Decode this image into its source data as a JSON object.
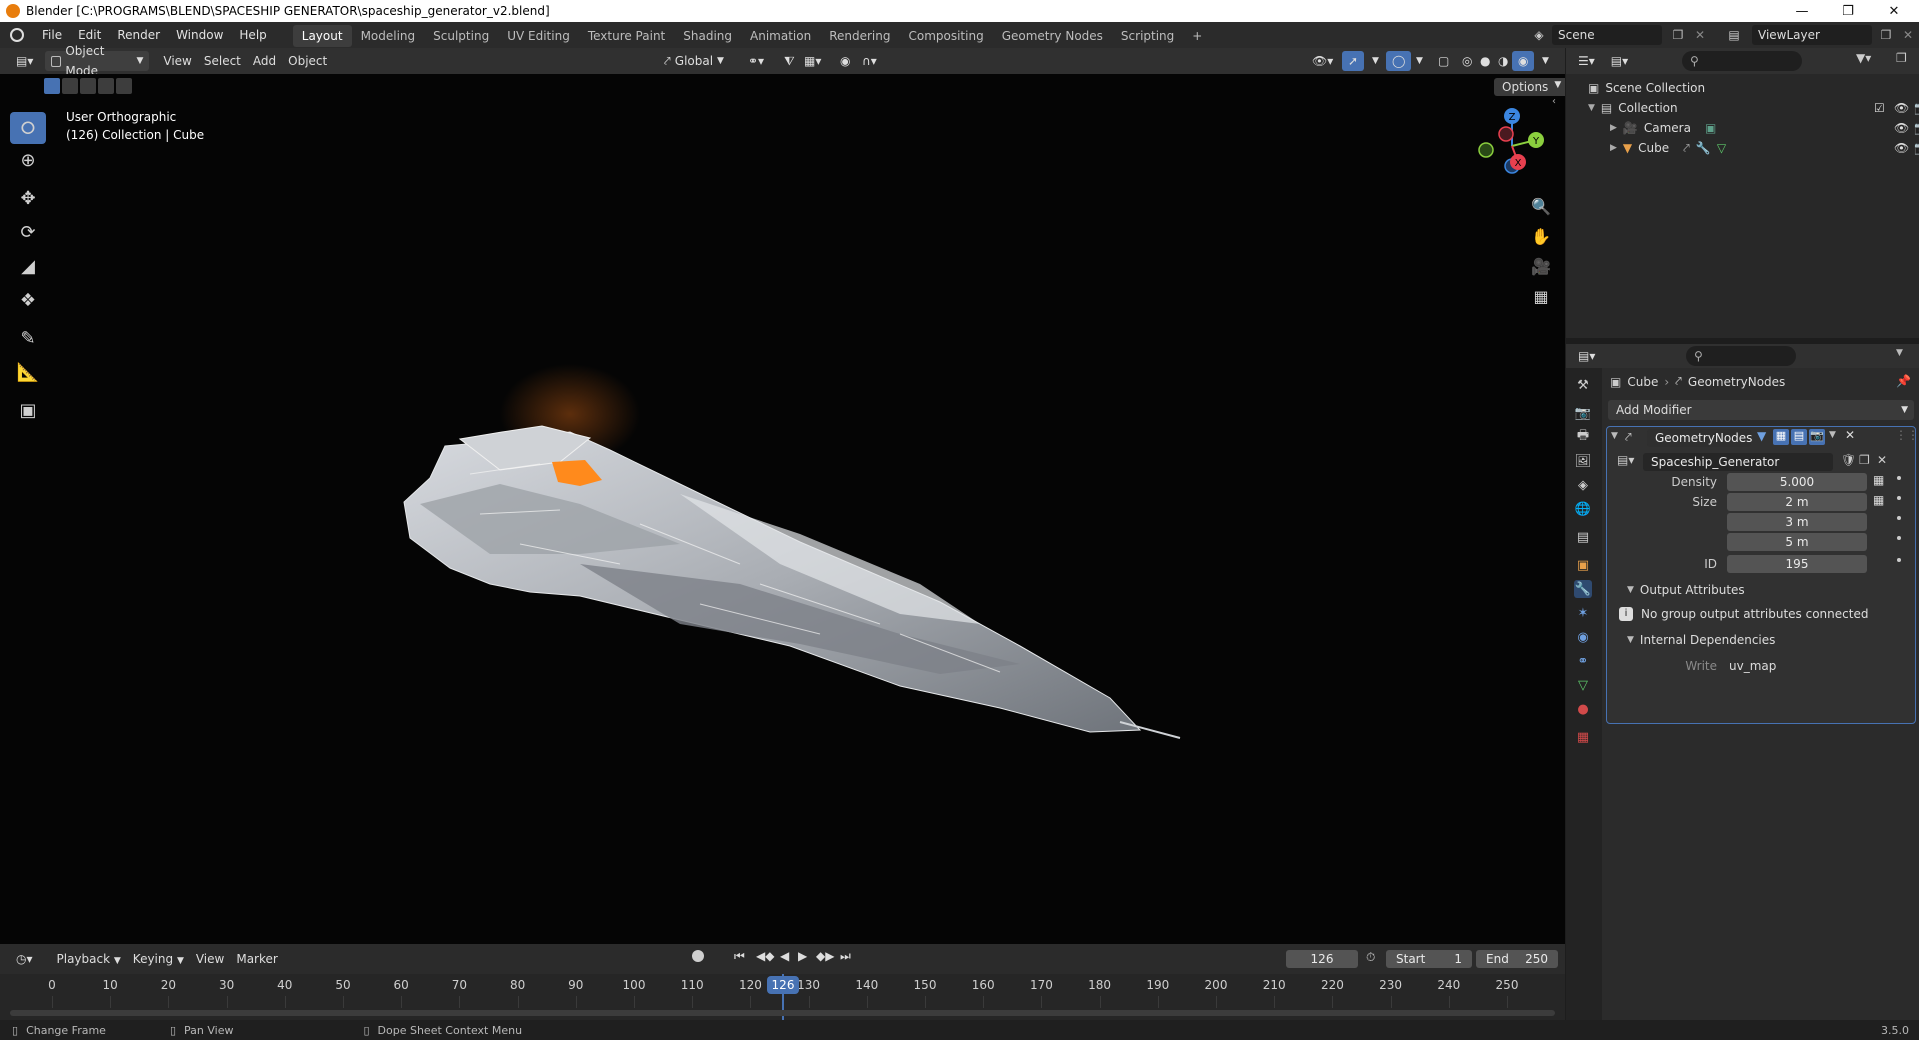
{
  "window": {
    "title": "Blender [C:\\PROGRAMS\\BLEND\\SPACESHIP GENERATOR\\spaceship_generator_v2.blend]",
    "minimize": "—",
    "restore": "❐",
    "close": "✕"
  },
  "menu": [
    "File",
    "Edit",
    "Render",
    "Window",
    "Help"
  ],
  "workspaces": [
    "Layout",
    "Modeling",
    "Sculpting",
    "UV Editing",
    "Texture Paint",
    "Shading",
    "Animation",
    "Rendering",
    "Compositing",
    "Geometry Nodes",
    "Scripting"
  ],
  "workspace_add": "+",
  "scene": {
    "name": "Scene",
    "view_layer": "ViewLayer"
  },
  "viewport_header": {
    "mode": "Object Mode",
    "menus": [
      "View",
      "Select",
      "Add",
      "Object"
    ],
    "transform_orientation": "Global",
    "options": "Options"
  },
  "viewport": {
    "view_name": "User Orthographic",
    "collection_info": "(126) Collection | Cube",
    "gizmo": {
      "z": "Z",
      "y": "Y",
      "x": "X"
    }
  },
  "outliner": {
    "root": "Scene Collection",
    "items": [
      {
        "name": "Collection",
        "level": 1
      },
      {
        "name": "Camera",
        "level": 2
      },
      {
        "name": "Cube",
        "level": 2
      }
    ]
  },
  "properties": {
    "breadcrumb": [
      "Cube",
      "GeometryNodes"
    ],
    "add_modifier": "Add Modifier",
    "modifier_name": "GeometryNodes",
    "node_group": "Spaceship_Generator",
    "inputs": {
      "density_label": "Density",
      "density_value": "5.000",
      "size_label": "Size",
      "size_x": "2 m",
      "size_y": "3 m",
      "size_z": "5 m",
      "id_label": "ID",
      "id_value": "195"
    },
    "output_attributes": "Output Attributes",
    "output_message": "No group output attributes connected",
    "internal_deps": "Internal Dependencies",
    "write_label": "Write",
    "write_value": "uv_map"
  },
  "timeline": {
    "menus": [
      "Playback",
      "Keying",
      "View",
      "Marker"
    ],
    "current_frame": "126",
    "start_label": "Start",
    "start_value": "1",
    "end_label": "End",
    "end_value": "250",
    "ticks": [
      "0",
      "10",
      "20",
      "30",
      "40",
      "50",
      "60",
      "70",
      "80",
      "90",
      "100",
      "110",
      "120",
      "130",
      "140",
      "150",
      "160",
      "170",
      "180",
      "190",
      "200",
      "210",
      "220",
      "230",
      "240",
      "250"
    ]
  },
  "statusbar": {
    "hint1": "Change Frame",
    "hint2": "Pan View",
    "hint3": "Dope Sheet Context Menu",
    "version": "3.5.0"
  },
  "colors": {
    "accent": "#4772b3",
    "active_frame": "#4772b3",
    "gizmo_x": "#e8404f",
    "gizmo_y": "#8bcf3e",
    "gizmo_z": "#3b86e0"
  }
}
